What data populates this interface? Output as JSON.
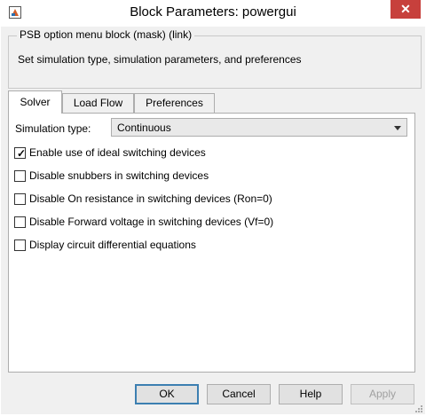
{
  "window": {
    "title": "Block Parameters: powergui",
    "close_glyph": "✕",
    "app_icon": "simulink-block-icon"
  },
  "mask": {
    "legend": "PSB option menu block (mask) (link)",
    "description": "Set simulation type, simulation parameters, and preferences"
  },
  "tabs": [
    {
      "label": "Solver",
      "active": true
    },
    {
      "label": "Load Flow",
      "active": false
    },
    {
      "label": "Preferences",
      "active": false
    }
  ],
  "solver": {
    "sim_type_label": "Simulation type:",
    "sim_type_value": "Continuous",
    "options": [
      {
        "label": "Enable use of ideal switching devices",
        "checked": true
      },
      {
        "label": "Disable snubbers in switching devices",
        "checked": false
      },
      {
        "label": "Disable On resistance in switching devices (Ron=0)",
        "checked": false
      },
      {
        "label": "Disable Forward voltage in switching devices (Vf=0)",
        "checked": false
      },
      {
        "label": "Display circuit differential equations",
        "checked": false
      }
    ]
  },
  "buttons": {
    "ok": "OK",
    "cancel": "Cancel",
    "help": "Help",
    "apply": "Apply"
  },
  "colors": {
    "close_button": "#c7403c",
    "dialog_bg": "#f0f0f0",
    "default_button_border": "#3c7fb1"
  }
}
